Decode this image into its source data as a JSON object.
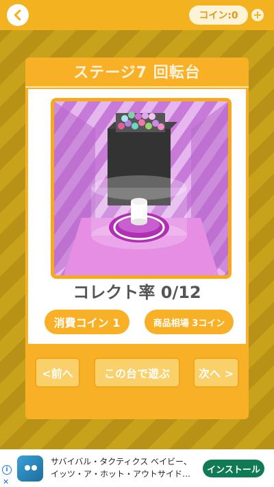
{
  "header": {
    "coin_label": "コイン:0",
    "plus_label": "+"
  },
  "stage": {
    "title": "ステージ7 回転台",
    "collect_rate": "コレクト率 0/12"
  },
  "info": {
    "cost_label": "消費コイン 1",
    "price_label": "商品相場 3コイン"
  },
  "nav": {
    "prev_label": "<前へ",
    "play_label": "この台で遊ぶ",
    "next_label": "次へ >"
  },
  "ad": {
    "line1": "サバイバル・タクティクス ベイビー、",
    "line2": "イッツ・ア・ホット・アウトサイド…",
    "install_label": "インストール",
    "info_icon": "i",
    "close_icon": "✕"
  },
  "colors": {
    "accent": "#f8b126",
    "install": "#0f7b54"
  }
}
